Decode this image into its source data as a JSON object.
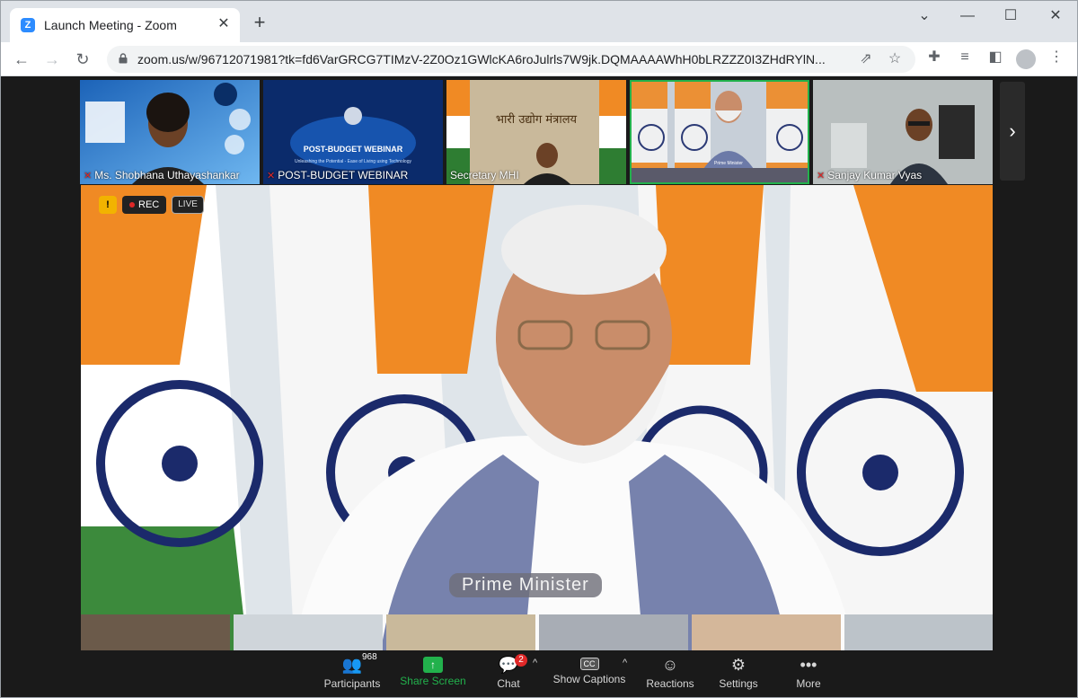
{
  "browser": {
    "tab_title": "Launch Meeting - Zoom",
    "tab_favicon_letter": "Z",
    "url": "zoom.us/w/96712071981?tk=fd6VarGRCG7TIMzV-2Z0Oz1GWlcKA6roJulrls7W9jk.DQMAAAAWhH0bLRZZZ0I3ZHdRYlN...",
    "window_buttons": [
      "⌄",
      "—",
      "☐",
      "✕"
    ]
  },
  "thumbnails": [
    {
      "label": "Ms. Shobhana Uthayashankar",
      "muted": true,
      "bg": "#2f80d6"
    },
    {
      "label": "POST-BUDGET WEBINAR",
      "muted": true,
      "bg": "#0b2b6b",
      "caption": "POST-BUDGET WEBINAR",
      "subcaption": "Unleashing the Potential - Ease of Living using Technology"
    },
    {
      "label": "Secretary MHI",
      "muted": false,
      "bg": "#b5a48a",
      "caption": "भारी उद्योग मंत्रालय"
    },
    {
      "label": "",
      "muted": false,
      "bg": "#c7cfd8",
      "sub": "Prime Minister"
    },
    {
      "label": "Sanjay Kumar Vyas",
      "muted": true,
      "bg": "#9aa0a0"
    }
  ],
  "main_video": {
    "shield": "!",
    "rec_label": "REC",
    "live_label": "LIVE",
    "speaker_name": "Prime Minister"
  },
  "controls": {
    "participants_label": "Participants",
    "participants_count": "968",
    "share_label": "Share Screen",
    "chat_label": "Chat",
    "chat_badge": "2",
    "captions_label": "Show Captions",
    "cc_text": "CC",
    "reactions_label": "Reactions",
    "settings_label": "Settings",
    "more_label": "More"
  },
  "colors": {
    "zoom_blue": "#2d8cff",
    "share_green": "#22b14c",
    "saffron": "#f08a24",
    "india_green": "#2e7d32",
    "muted_red": "#e02828"
  }
}
